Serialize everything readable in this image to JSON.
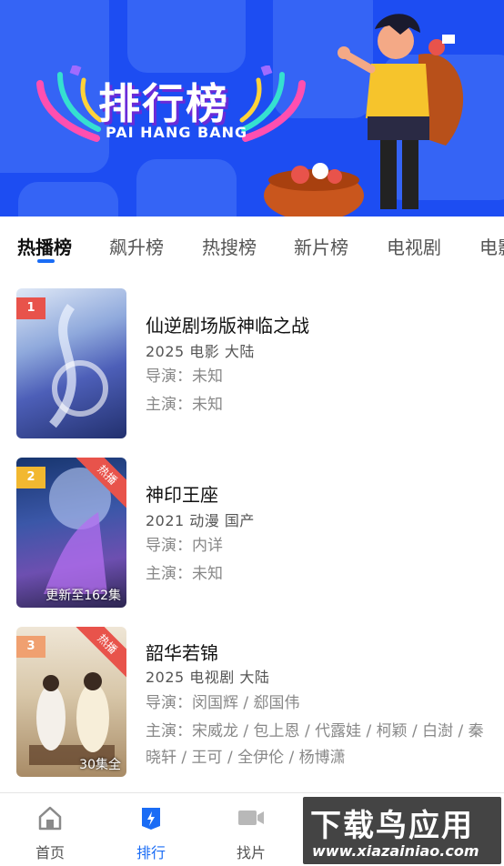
{
  "banner": {
    "title": "排行榜",
    "subtitle": "PAI HANG BANG",
    "bg_color": "#1d4df2"
  },
  "tabs": [
    {
      "label": "热播榜",
      "active": true
    },
    {
      "label": "飙升榜",
      "active": false
    },
    {
      "label": "热搜榜",
      "active": false
    },
    {
      "label": "新片榜",
      "active": false
    },
    {
      "label": "电视剧",
      "active": false
    },
    {
      "label": "电影",
      "active": false
    }
  ],
  "items": [
    {
      "rank": "1",
      "rank_color": "#e8534b",
      "title": "仙逆剧场版神临之战",
      "meta": "2025  电影  大陆",
      "director": "导演：未知",
      "cast": "主演：未知",
      "badge": "",
      "episode": ""
    },
    {
      "rank": "2",
      "rank_color": "#f2b830",
      "title": "神印王座",
      "meta": "2021  动漫  国产",
      "director": "导演：内详",
      "cast": "主演：未知",
      "badge": "热播",
      "episode": "更新至162集"
    },
    {
      "rank": "3",
      "rank_color": "#f0a070",
      "title": "韶华若锦",
      "meta": "2025  电视剧  大陆",
      "director": "导演：闵国辉 / 郄国伟",
      "cast": "主演：宋威龙 / 包上恩 / 代露娃 / 柯颖 / 白澍 / 秦晓轩 / 王可 / 全伊伦 / 杨博潇",
      "badge": "热播",
      "episode": "30集全"
    }
  ],
  "nav": [
    {
      "label": "首页",
      "icon": "home-icon",
      "active": false
    },
    {
      "label": "排行",
      "icon": "ranking-icon",
      "active": true
    },
    {
      "label": "找片",
      "icon": "video-camera-icon",
      "active": false
    }
  ],
  "watermark": {
    "main": "下载鸟应用",
    "url": "www.xiazainiao.com"
  },
  "colors": {
    "accent": "#1a6cf5",
    "hot": "#e8534b"
  }
}
